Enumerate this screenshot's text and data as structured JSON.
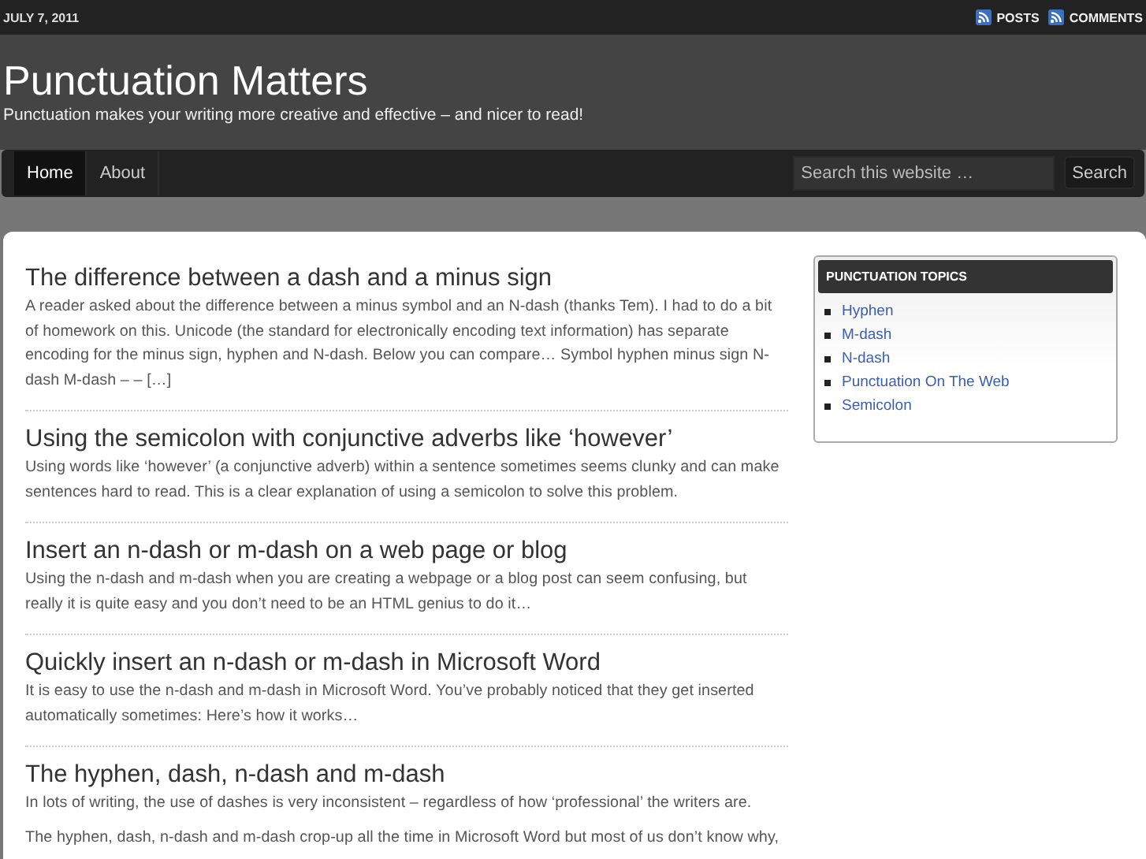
{
  "top_bar": {
    "date": "JULY 7, 2011",
    "feeds": [
      "POSTS",
      "COMMENTS"
    ]
  },
  "header": {
    "title": "Punctuation Matters",
    "tagline": "Punctuation makes your writing more creative and effective – and nicer to read!"
  },
  "nav": {
    "items": [
      {
        "label": "Home",
        "selected": true
      },
      {
        "label": "About",
        "selected": false
      }
    ],
    "search": {
      "placeholder": "Search this website …",
      "button": "Search"
    }
  },
  "posts": [
    {
      "title": "The difference between a dash and a minus sign",
      "paragraphs": [
        "A reader asked about the difference between a minus symbol and an N-dash (thanks Tem).  I had to do a bit of homework on this. Unicode (the standard for electronically encoding text information) has separate encoding for the minus sign, hyphen and N-dash. Below you can compare… Symbol hyphen minus sign N-dash M-dash – – […]"
      ]
    },
    {
      "title": "Using the semicolon with conjunctive adverbs like ‘however’",
      "paragraphs": [
        "Using words like ‘however’ (a conjunctive adverb) within a sentence sometimes seems clunky and can make sentences hard to read. This is a clear explanation of using a semicolon to solve this problem."
      ]
    },
    {
      "title": "Insert an n-dash or m-dash on a web page or blog",
      "paragraphs": [
        "Using the n-dash and m-dash when you are creating a webpage or a blog post can seem confusing, but really it is quite easy and you don’t need to be an HTML genius to do it…"
      ]
    },
    {
      "title": "Quickly insert an n-dash or m-dash in Microsoft Word",
      "paragraphs": [
        "It is easy to use the n-dash and m-dash in Microsoft Word. You’ve probably noticed that they get inserted automatically sometimes: Here’s how it works…"
      ]
    },
    {
      "title": "The hyphen, dash, n-dash and m-dash",
      "paragraphs": [
        "In lots of writing, the use of dashes is very inconsistent – regardless of how ‘professional’ the writers are.",
        "The hyphen, dash, n-dash and m-dash crop-up all the time in Microsoft Word but most of us don’t know why,"
      ]
    }
  ],
  "sidebar": {
    "title": "PUNCTUATION TOPICS",
    "items": [
      "Hyphen",
      "M-dash",
      "N-dash",
      "Punctuation On The Web",
      "Semicolon"
    ]
  }
}
